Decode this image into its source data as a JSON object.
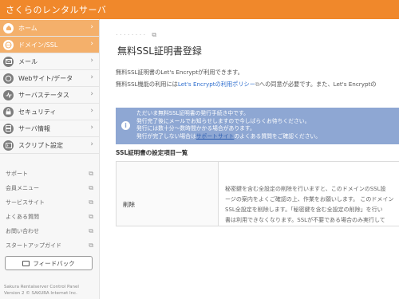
{
  "app": {
    "title": "さくらのレンタルサーバ"
  },
  "sidebar": {
    "items": [
      {
        "label": "ホーム",
        "icon": "home-icon",
        "active": true
      },
      {
        "label": "ドメイン/SSL",
        "icon": "globe-icon",
        "active": true
      },
      {
        "label": "メール",
        "icon": "mail-icon",
        "active": false
      },
      {
        "label": "Webサイト/データ",
        "icon": "web-icon",
        "active": false
      },
      {
        "label": "サーバステータス",
        "icon": "status-icon",
        "active": false
      },
      {
        "label": "セキュリティ",
        "icon": "lock-icon",
        "active": false
      },
      {
        "label": "サーバ情報",
        "icon": "server-icon",
        "active": false
      },
      {
        "label": "スクリプト設定",
        "icon": "script-icon",
        "active": false
      }
    ],
    "links": [
      {
        "label": "サポート"
      },
      {
        "label": "会員メニュー"
      },
      {
        "label": "サービスサイト"
      },
      {
        "label": "よくある質問"
      },
      {
        "label": "お問い合わせ"
      },
      {
        "label": "スタートアップガイド"
      }
    ],
    "feedback_label": "フィードバック",
    "footer_line1": "Sakura Rentalserver Control Panel",
    "footer_line2": "Version 2 © SAKURA Internet Inc."
  },
  "main": {
    "title": "無料SSL証明書登録",
    "lead1": "無料SSL証明書のLet's Encryptが利用できます。",
    "lead2_prefix": "無料SSL機能の利用には",
    "lead2_link": "Let's Encryptの利用ポリシー",
    "lead2_suffix": "への同意が必要です。また、Let's Encryptの",
    "notice": {
      "line1": "ただいま無料SSL証明書の発行手続き中です。",
      "line2": "発行完了後にメールでお知らせしますので今しばらくお待ちください。",
      "line3": "発行には数十分～数時間かかる場合があります。",
      "line4_prefix": "発行が完了しない場合は",
      "line4_link": "サポートサイト",
      "line4_suffix": "のよくある質問をご確認ください。"
    },
    "section_heading": "SSL証明書の設定項目一覧",
    "table": {
      "row_label": "削除",
      "desc1": "秘密鍵を含む全設定の削除を行いますと、このドメインのSSL設",
      "desc2": "ージの案内をよくご確認の上、作業をお願いします。 このドメイン",
      "desc3": "SSL全設定を削除します。「秘密鍵を含む全設定の削除」を行い",
      "desc4": "書は利用できなくなります。SSLが不要である場合のみ実行して"
    }
  },
  "colors": {
    "brand": "#f0882b",
    "active": "#f4b06b",
    "notice": "#8ea7d3",
    "link": "#2f6fcf"
  }
}
